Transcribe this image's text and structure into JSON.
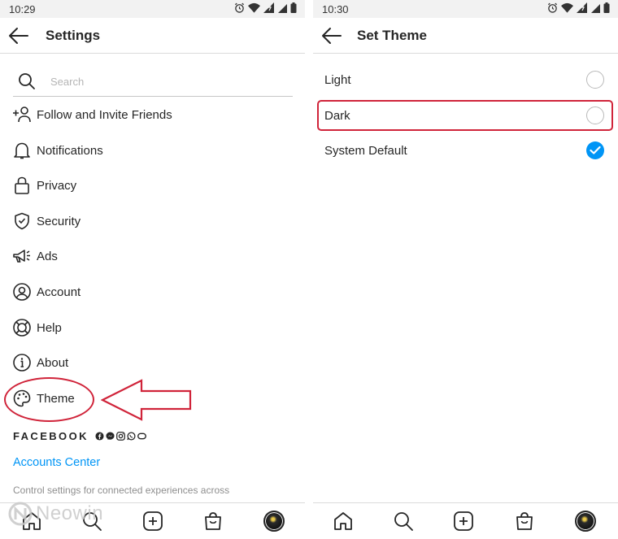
{
  "left_screen": {
    "status_time": "10:29",
    "header_title": "Settings",
    "search_placeholder": "Search",
    "menu": [
      {
        "label": "Follow and Invite Friends",
        "icon": "add-person-icon"
      },
      {
        "label": "Notifications",
        "icon": "bell-icon"
      },
      {
        "label": "Privacy",
        "icon": "lock-icon"
      },
      {
        "label": "Security",
        "icon": "shield-check-icon"
      },
      {
        "label": "Ads",
        "icon": "megaphone-icon"
      },
      {
        "label": "Account",
        "icon": "account-circle-icon"
      },
      {
        "label": "Help",
        "icon": "lifebuoy-icon"
      },
      {
        "label": "About",
        "icon": "info-icon"
      },
      {
        "label": "Theme",
        "icon": "palette-icon"
      }
    ],
    "facebook_label": "FACEBOOK",
    "facebook_icons": [
      "facebook-icon",
      "messenger-icon",
      "instagram-icon",
      "whatsapp-icon",
      "portal-icon"
    ],
    "accounts_center": "Accounts Center",
    "control_text": "Control settings for connected experiences across"
  },
  "right_screen": {
    "status_time": "10:30",
    "header_title": "Set Theme",
    "options": [
      {
        "label": "Light",
        "selected": false
      },
      {
        "label": "Dark",
        "selected": false
      },
      {
        "label": "System Default",
        "selected": true
      }
    ]
  },
  "tabbar_icons": [
    "home-icon",
    "search-icon",
    "new-post-icon",
    "shop-icon",
    "profile-avatar"
  ],
  "watermark": "Neowin",
  "colors": {
    "accent_blue": "#0095f6",
    "annotation_red": "#d0243a",
    "text": "#262626",
    "divider": "#dbdbdb"
  }
}
